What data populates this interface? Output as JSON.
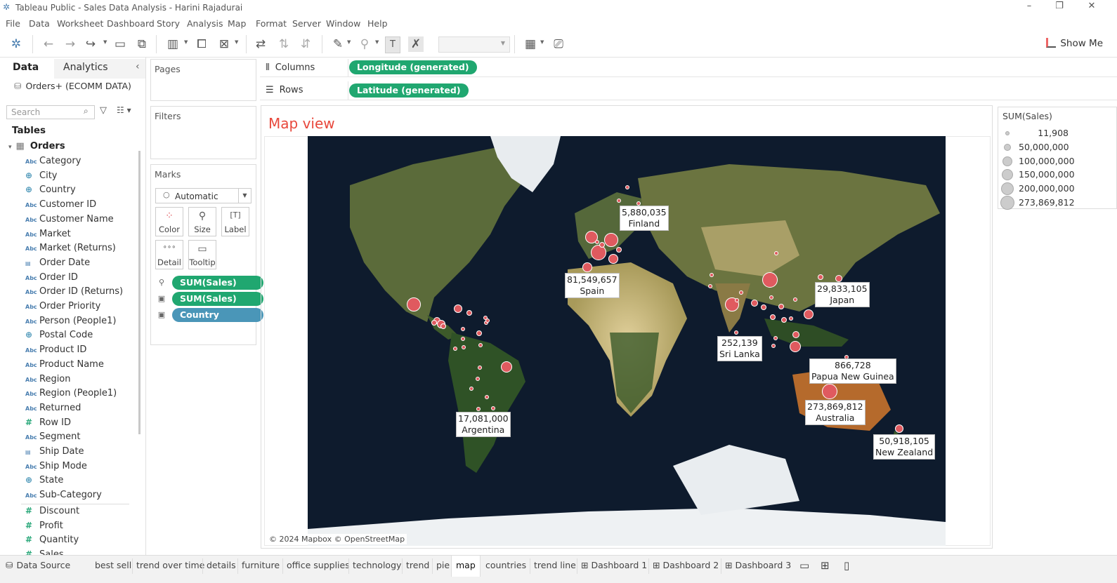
{
  "window": {
    "title": "Tableau Public - Sales Data Analysis - Harini Rajadurai"
  },
  "menu": [
    "File",
    "Data",
    "Worksheet",
    "Dashboard",
    "Story",
    "Analysis",
    "Map",
    "Format",
    "Server",
    "Window",
    "Help"
  ],
  "toolbar": {
    "show_me": "Show Me"
  },
  "left_pane": {
    "tabs": {
      "data": "Data",
      "analytics": "Analytics"
    },
    "datasource": "Orders+ (ECOMM DATA)",
    "search_placeholder": "Search",
    "tables_label": "Tables",
    "table_name": "Orders",
    "fields": [
      {
        "type": "Abc",
        "name": "Category"
      },
      {
        "type": "geo",
        "name": "City"
      },
      {
        "type": "geo",
        "name": "Country"
      },
      {
        "type": "Abc",
        "name": "Customer ID"
      },
      {
        "type": "Abc",
        "name": "Customer Name"
      },
      {
        "type": "Abc",
        "name": "Market"
      },
      {
        "type": "Abc",
        "name": "Market (Returns)"
      },
      {
        "type": "date",
        "name": "Order Date"
      },
      {
        "type": "Abc",
        "name": "Order ID"
      },
      {
        "type": "Abc",
        "name": "Order ID (Returns)"
      },
      {
        "type": "Abc",
        "name": "Order Priority"
      },
      {
        "type": "Abc",
        "name": "Person (People1)"
      },
      {
        "type": "geo",
        "name": "Postal Code"
      },
      {
        "type": "Abc",
        "name": "Product ID"
      },
      {
        "type": "Abc",
        "name": "Product Name"
      },
      {
        "type": "Abc",
        "name": "Region"
      },
      {
        "type": "Abc",
        "name": "Region (People1)"
      },
      {
        "type": "Abc",
        "name": "Returned"
      },
      {
        "type": "#",
        "name": "Row ID"
      },
      {
        "type": "Abc",
        "name": "Segment"
      },
      {
        "type": "date",
        "name": "Ship Date"
      },
      {
        "type": "Abc",
        "name": "Ship Mode"
      },
      {
        "type": "geo",
        "name": "State"
      },
      {
        "type": "Abc",
        "name": "Sub-Category"
      }
    ],
    "measures": [
      {
        "type": "#",
        "name": "Discount"
      },
      {
        "type": "#",
        "name": "Profit"
      },
      {
        "type": "#",
        "name": "Quantity"
      },
      {
        "type": "#",
        "name": "Sales"
      }
    ]
  },
  "shelves": {
    "pages": "Pages",
    "filters": "Filters",
    "marks": "Marks",
    "mark_type": "Automatic",
    "mark_buttons": [
      "Color",
      "Size",
      "Label",
      "Detail",
      "Tooltip"
    ],
    "mark_pills": [
      {
        "icon": "size",
        "label": "SUM(Sales)",
        "color": "green"
      },
      {
        "icon": "label",
        "label": "SUM(Sales)",
        "color": "green"
      },
      {
        "icon": "label",
        "label": "Country",
        "color": "blue"
      }
    ],
    "columns_label": "Columns",
    "columns_pill": "Longitude (generated)",
    "rows_label": "Rows",
    "rows_pill": "Latitude (generated)"
  },
  "view": {
    "title": "Map view",
    "copyright": "© 2024 Mapbox © OpenStreetMap",
    "labels": [
      {
        "value": "5,880,035",
        "country": "Finland"
      },
      {
        "value": "81,549,657",
        "country": "Spain"
      },
      {
        "value": "29,833,105",
        "country": "Japan"
      },
      {
        "value": "252,139",
        "country": "Sri Lanka"
      },
      {
        "value": "866,728",
        "country": "Papua New Guinea"
      },
      {
        "value": "273,869,812",
        "country": "Australia"
      },
      {
        "value": "17,081,000",
        "country": "Argentina"
      },
      {
        "value": "50,918,105",
        "country": "New Zealand"
      }
    ]
  },
  "legend": {
    "title": "SUM(Sales)",
    "items": [
      "11,908",
      "50,000,000",
      "100,000,000",
      "150,000,000",
      "200,000,000",
      "273,869,812"
    ]
  },
  "sheet_tabs": {
    "datasource": "Data Source",
    "tabs": [
      "best sell",
      "trend over time",
      "details",
      "furniture",
      "office supplies",
      "technology",
      "trend",
      "pie",
      "map",
      "countries",
      "trend line",
      "Dashboard 1",
      "Dashboard 2",
      "Dashboard 3"
    ],
    "active": "map"
  },
  "colors": {
    "accent_green": "#20a770",
    "accent_blue": "#4a96b8",
    "mark_red": "#e05a5f",
    "title_red": "#e8483c"
  }
}
